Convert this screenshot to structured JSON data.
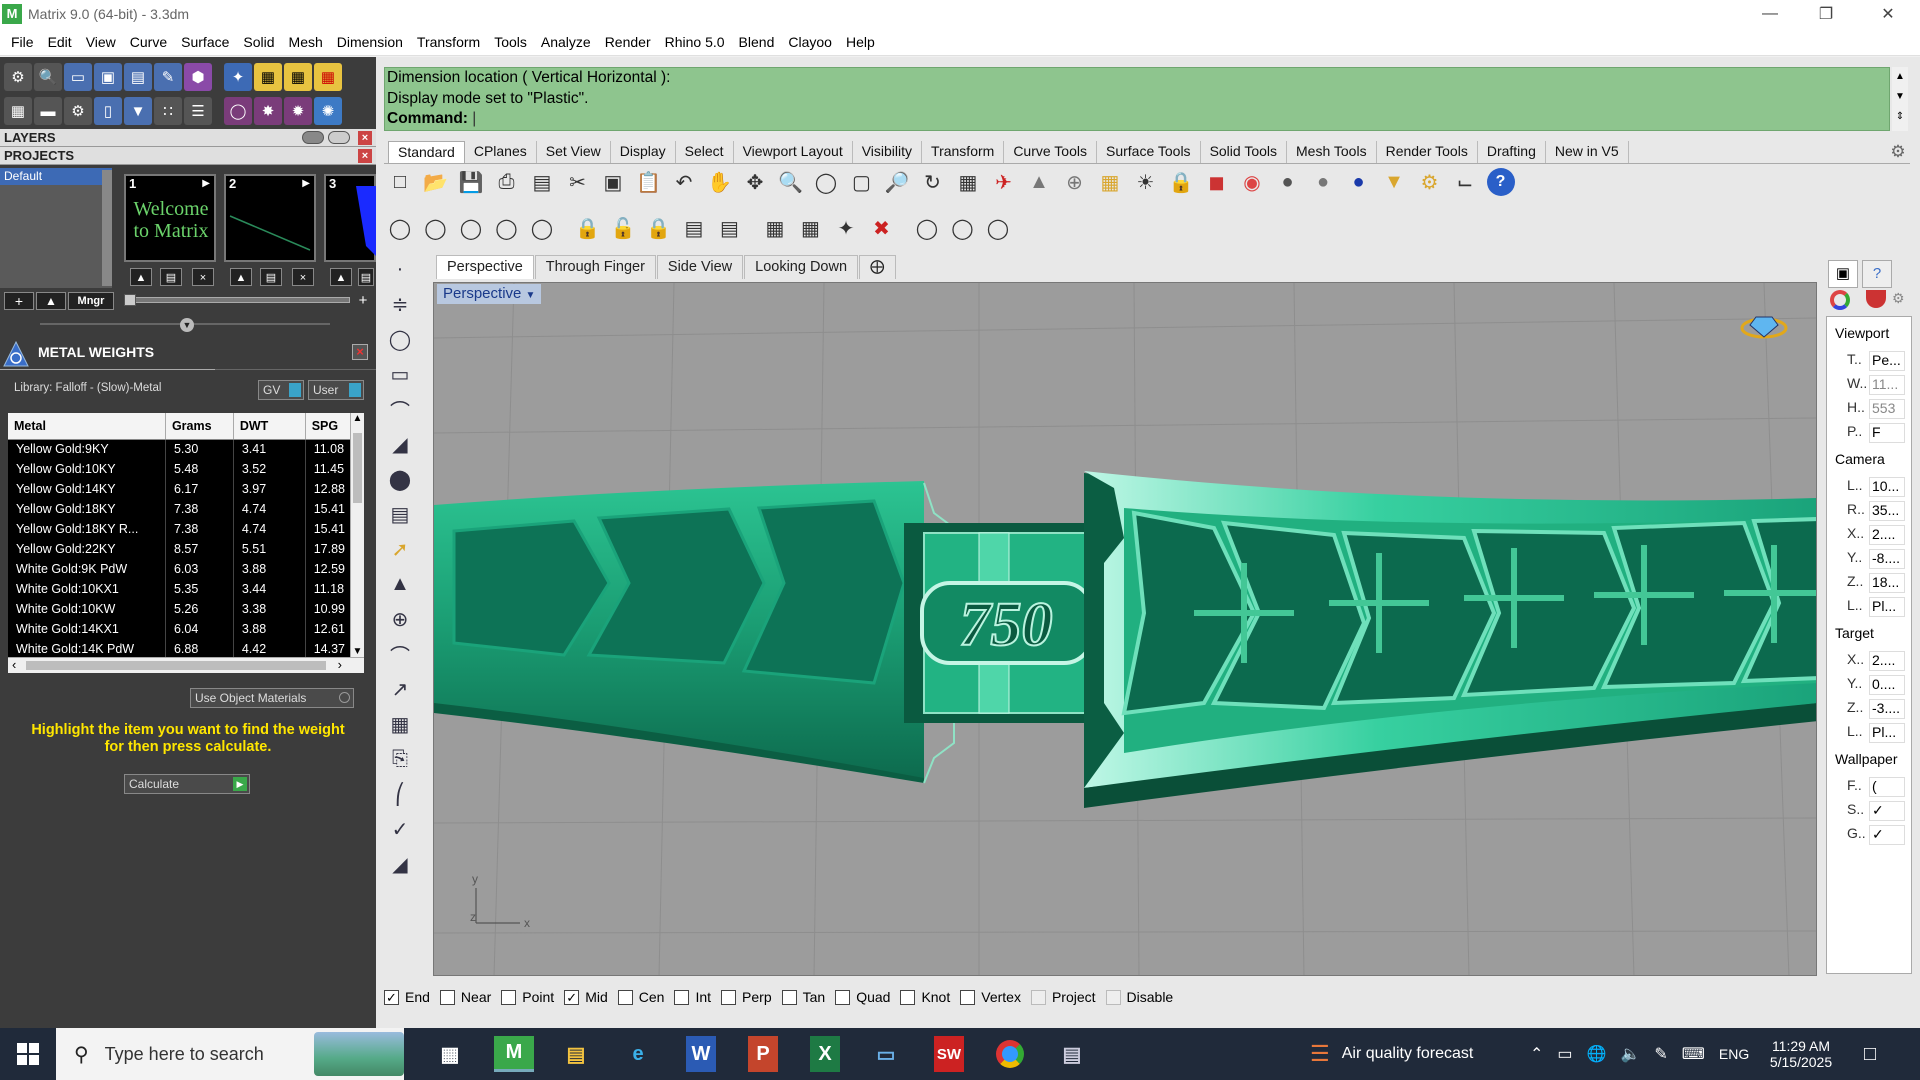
{
  "window": {
    "title": "Matrix 9.0 (64-bit) - 3.3dm"
  },
  "menu": [
    "File",
    "Edit",
    "View",
    "Curve",
    "Surface",
    "Solid",
    "Mesh",
    "Dimension",
    "Transform",
    "Tools",
    "Analyze",
    "Render",
    "Rhino 5.0",
    "Blend",
    "Clayoo",
    "Help"
  ],
  "left": {
    "layers_label": "LAYERS",
    "projects_label": "PROJECTS",
    "layer_default": "Default",
    "thumbs": [
      {
        "num": "1",
        "text": "Welcome to Matrix"
      },
      {
        "num": "2",
        "text": ""
      },
      {
        "num": "3",
        "text": ""
      }
    ],
    "mngr_label": "Mngr",
    "metal_weights": {
      "title": "METAL WEIGHTS",
      "library": "Library: Falloff - (Slow)-Metal",
      "gv": "GV",
      "user": "User",
      "columns": [
        "Metal",
        "Grams",
        "DWT",
        "SPG"
      ],
      "rows": [
        [
          "Yellow Gold:9KY",
          "5.30",
          "3.41",
          "11.08"
        ],
        [
          "Yellow Gold:10KY",
          "5.48",
          "3.52",
          "11.45"
        ],
        [
          "Yellow Gold:14KY",
          "6.17",
          "3.97",
          "12.88"
        ],
        [
          "Yellow Gold:18KY",
          "7.38",
          "4.74",
          "15.41"
        ],
        [
          "Yellow Gold:18KY R...",
          "7.38",
          "4.74",
          "15.41"
        ],
        [
          "Yellow Gold:22KY",
          "8.57",
          "5.51",
          "17.89"
        ],
        [
          "White Gold:9K PdW",
          "6.03",
          "3.88",
          "12.59"
        ],
        [
          "White Gold:10KX1",
          "5.35",
          "3.44",
          "11.18"
        ],
        [
          "White Gold:10KW",
          "5.26",
          "3.38",
          "10.99"
        ],
        [
          "White Gold:14KX1",
          "6.04",
          "3.88",
          "12.61"
        ],
        [
          "White Gold:14K PdW",
          "6.88",
          "4.42",
          "14.37"
        ]
      ],
      "use_object_materials": "Use Object Materials",
      "note": "Highlight the item you want to find the weight for then press calculate.",
      "calculate": "Calculate"
    }
  },
  "command": {
    "line1": "Dimension location ( Vertical  Horizontal ):",
    "line2": "Display mode set to \"Plastic\".",
    "prompt": "Command:"
  },
  "toolbar_tabs": [
    "Standard",
    "CPlanes",
    "Set View",
    "Display",
    "Select",
    "Viewport Layout",
    "Visibility",
    "Transform",
    "Curve Tools",
    "Surface Tools",
    "Solid Tools",
    "Mesh Tools",
    "Render Tools",
    "Drafting",
    "New in V5"
  ],
  "viewport_tabs": [
    "Perspective",
    "Through Finger",
    "Side View",
    "Looking Down"
  ],
  "viewport_label": "Perspective",
  "ring_stamp": "750",
  "axes": {
    "y": "y",
    "x": "x",
    "z": "z"
  },
  "snaps": [
    {
      "label": "End",
      "checked": true
    },
    {
      "label": "Near",
      "checked": false
    },
    {
      "label": "Point",
      "checked": false
    },
    {
      "label": "Mid",
      "checked": true
    },
    {
      "label": "Cen",
      "checked": false
    },
    {
      "label": "Int",
      "checked": false
    },
    {
      "label": "Perp",
      "checked": false
    },
    {
      "label": "Tan",
      "checked": false
    },
    {
      "label": "Quad",
      "checked": false
    },
    {
      "label": "Knot",
      "checked": false
    },
    {
      "label": "Vertex",
      "checked": false
    },
    {
      "label": "Project",
      "checked": false,
      "disabled": true
    },
    {
      "label": "Disable",
      "checked": false,
      "disabled": true
    }
  ],
  "properties": {
    "viewport_label": "Viewport",
    "viewport": [
      {
        "k": "T..",
        "v": "Pe..."
      },
      {
        "k": "W..",
        "v": "11..."
      },
      {
        "k": "H..",
        "v": "553"
      },
      {
        "k": "P..",
        "v": "F"
      }
    ],
    "camera_label": "Camera",
    "camera": [
      {
        "k": "L..",
        "v": "10..."
      },
      {
        "k": "R..",
        "v": "35..."
      },
      {
        "k": "X..",
        "v": "2...."
      },
      {
        "k": "Y..",
        "v": "-8...."
      },
      {
        "k": "Z..",
        "v": "18..."
      },
      {
        "k": "L..",
        "v": "Pl..."
      }
    ],
    "target_label": "Target",
    "target": [
      {
        "k": "X..",
        "v": "2...."
      },
      {
        "k": "Y..",
        "v": "0...."
      },
      {
        "k": "Z..",
        "v": "-3...."
      },
      {
        "k": "L..",
        "v": "Pl..."
      }
    ],
    "wallpaper_label": "Wallpaper",
    "wallpaper": [
      {
        "k": "F..",
        "v": "("
      },
      {
        "k": "S..",
        "v": "✓"
      },
      {
        "k": "G..",
        "v": "✓"
      }
    ]
  },
  "taskbar": {
    "search_placeholder": "Type here to search",
    "weather": "Air quality forecast",
    "lang": "ENG",
    "time": "11:29 AM",
    "date": "5/15/2025"
  },
  "colors": {
    "ring": "#1fa37b",
    "ring_light": "#7fe6c6",
    "ring_dark": "#0c5e45",
    "cmd_bg": "#8ec58e"
  }
}
